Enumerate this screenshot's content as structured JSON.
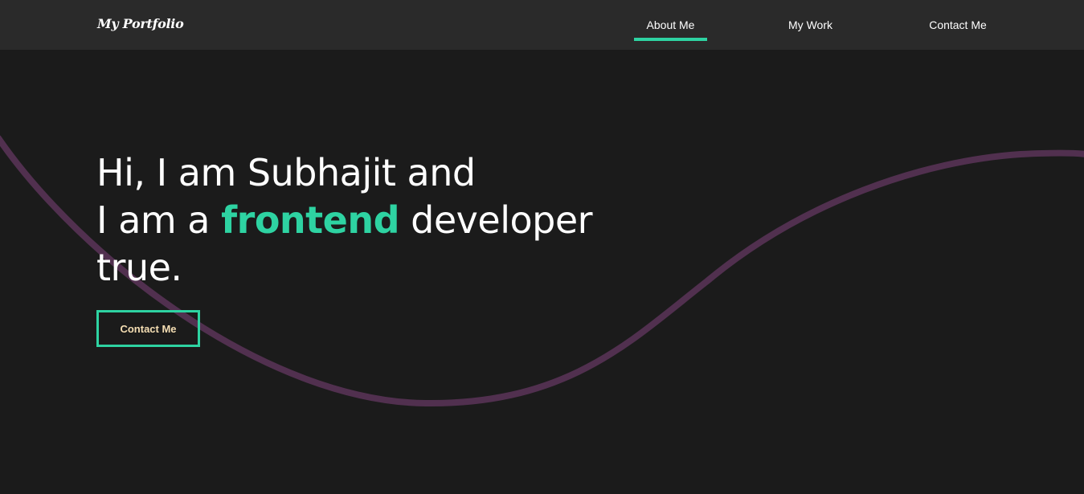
{
  "colors": {
    "background": "#1b1b1b",
    "navbar": "#2a2a2a",
    "accent": "#2ed3a2",
    "wave": "#51304f",
    "button_text": "#f5deb3",
    "text": "#ffffff"
  },
  "navbar": {
    "logo": "My Portfolio",
    "items": [
      {
        "label": "About Me",
        "active": true
      },
      {
        "label": "My Work",
        "active": false
      },
      {
        "label": "Contact Me",
        "active": false
      }
    ]
  },
  "hero": {
    "line1": "Hi, I am Subhajit and",
    "line2_prefix": "I am a ",
    "line2_highlight": "frontend",
    "line2_suffix": " developer",
    "line3": "true.",
    "cta_label": "Contact Me"
  }
}
